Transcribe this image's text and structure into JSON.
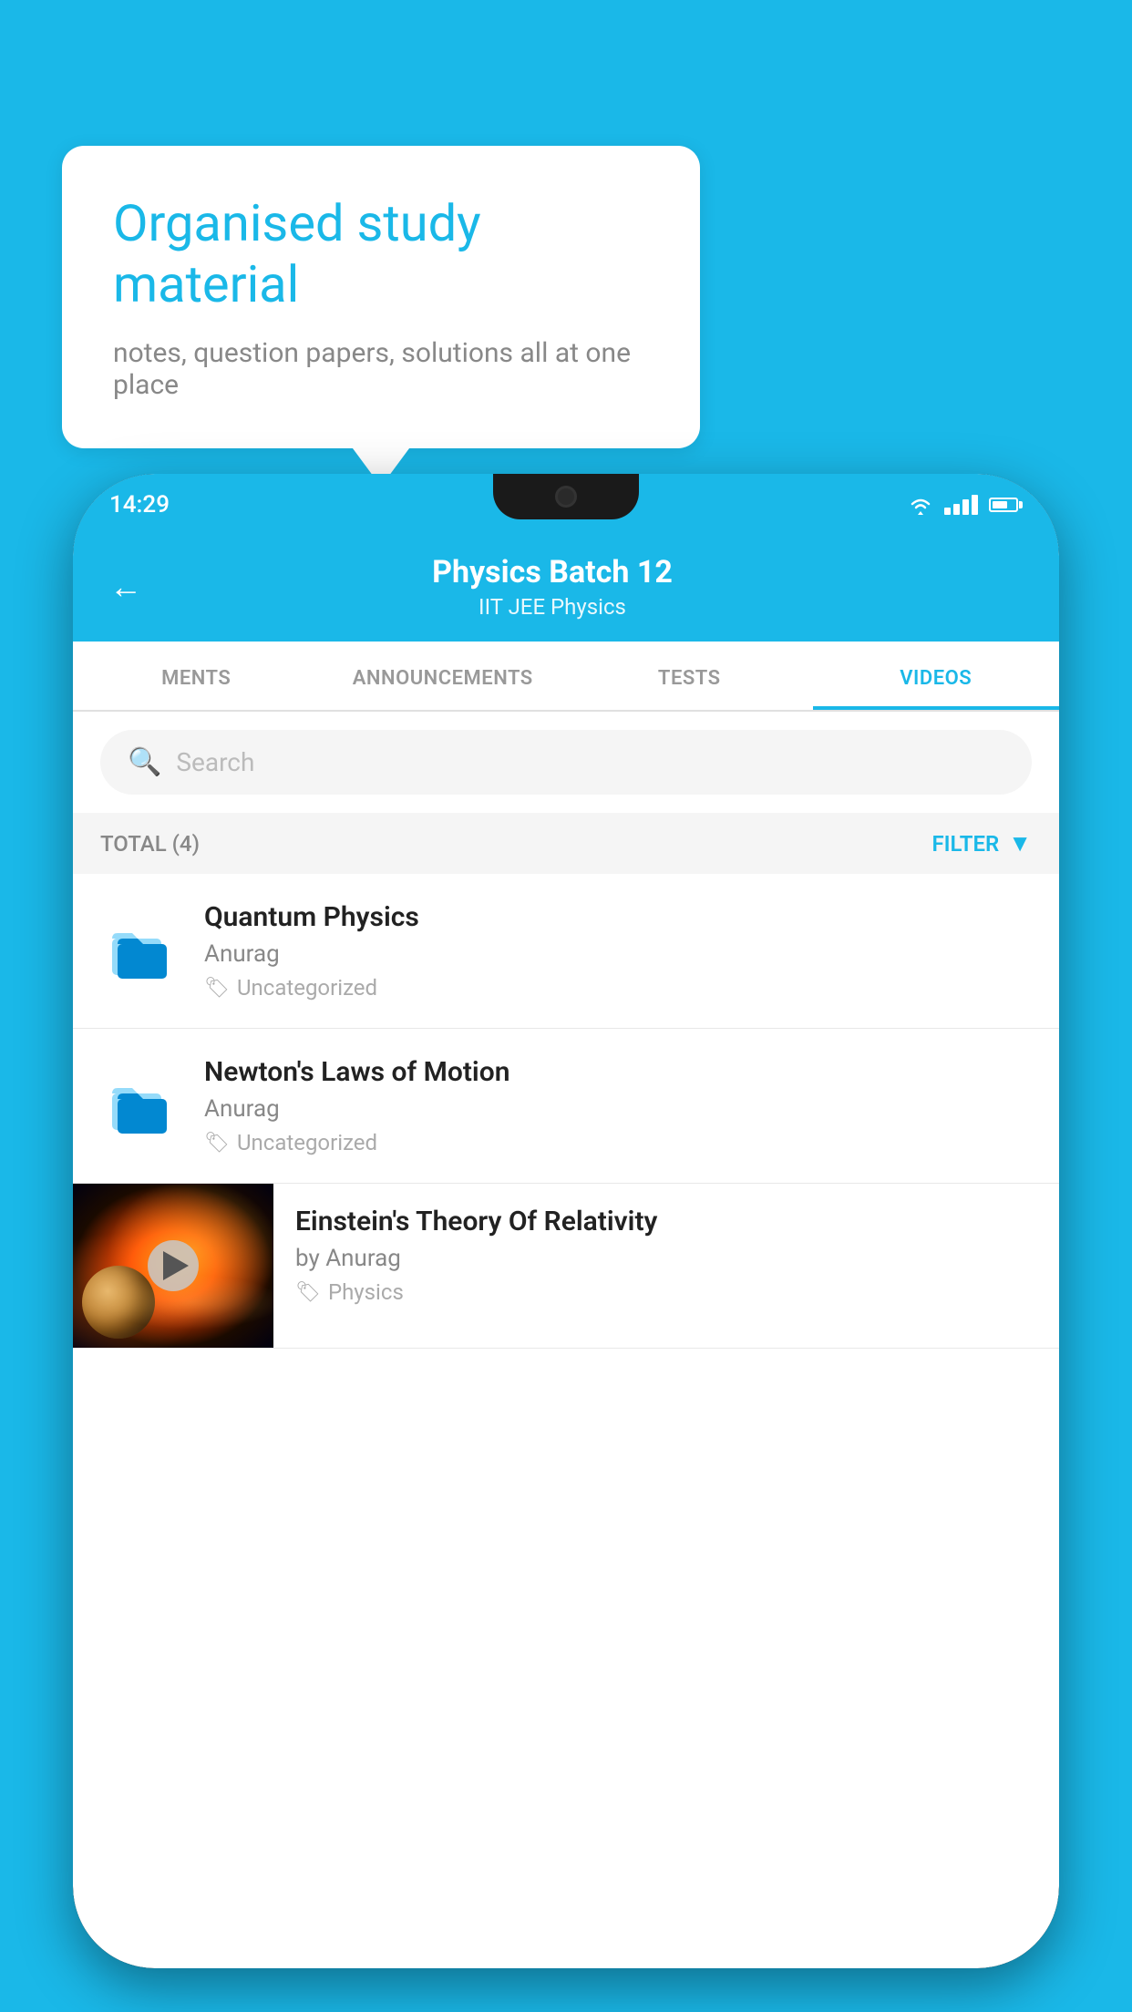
{
  "background_color": "#1ab8e8",
  "speech_bubble": {
    "title": "Organised study material",
    "subtitle": "notes, question papers, solutions all at one place"
  },
  "phone": {
    "status_bar": {
      "time": "14:29"
    },
    "header": {
      "title": "Physics Batch 12",
      "subtitle": "IIT JEE    Physics",
      "back_label": "←"
    },
    "tabs": [
      {
        "label": "MENTS",
        "active": false
      },
      {
        "label": "ANNOUNCEMENTS",
        "active": false
      },
      {
        "label": "TESTS",
        "active": false
      },
      {
        "label": "VIDEOS",
        "active": true
      }
    ],
    "search": {
      "placeholder": "Search"
    },
    "filter": {
      "total_label": "TOTAL (4)",
      "filter_label": "FILTER"
    },
    "videos": [
      {
        "id": 1,
        "title": "Quantum Physics",
        "author": "Anurag",
        "tag": "Uncategorized",
        "has_thumb": false
      },
      {
        "id": 2,
        "title": "Newton's Laws of Motion",
        "author": "Anurag",
        "tag": "Uncategorized",
        "has_thumb": false
      },
      {
        "id": 3,
        "title": "Einstein's Theory Of Relativity",
        "author": "by Anurag",
        "tag": "Physics",
        "has_thumb": true
      }
    ]
  }
}
